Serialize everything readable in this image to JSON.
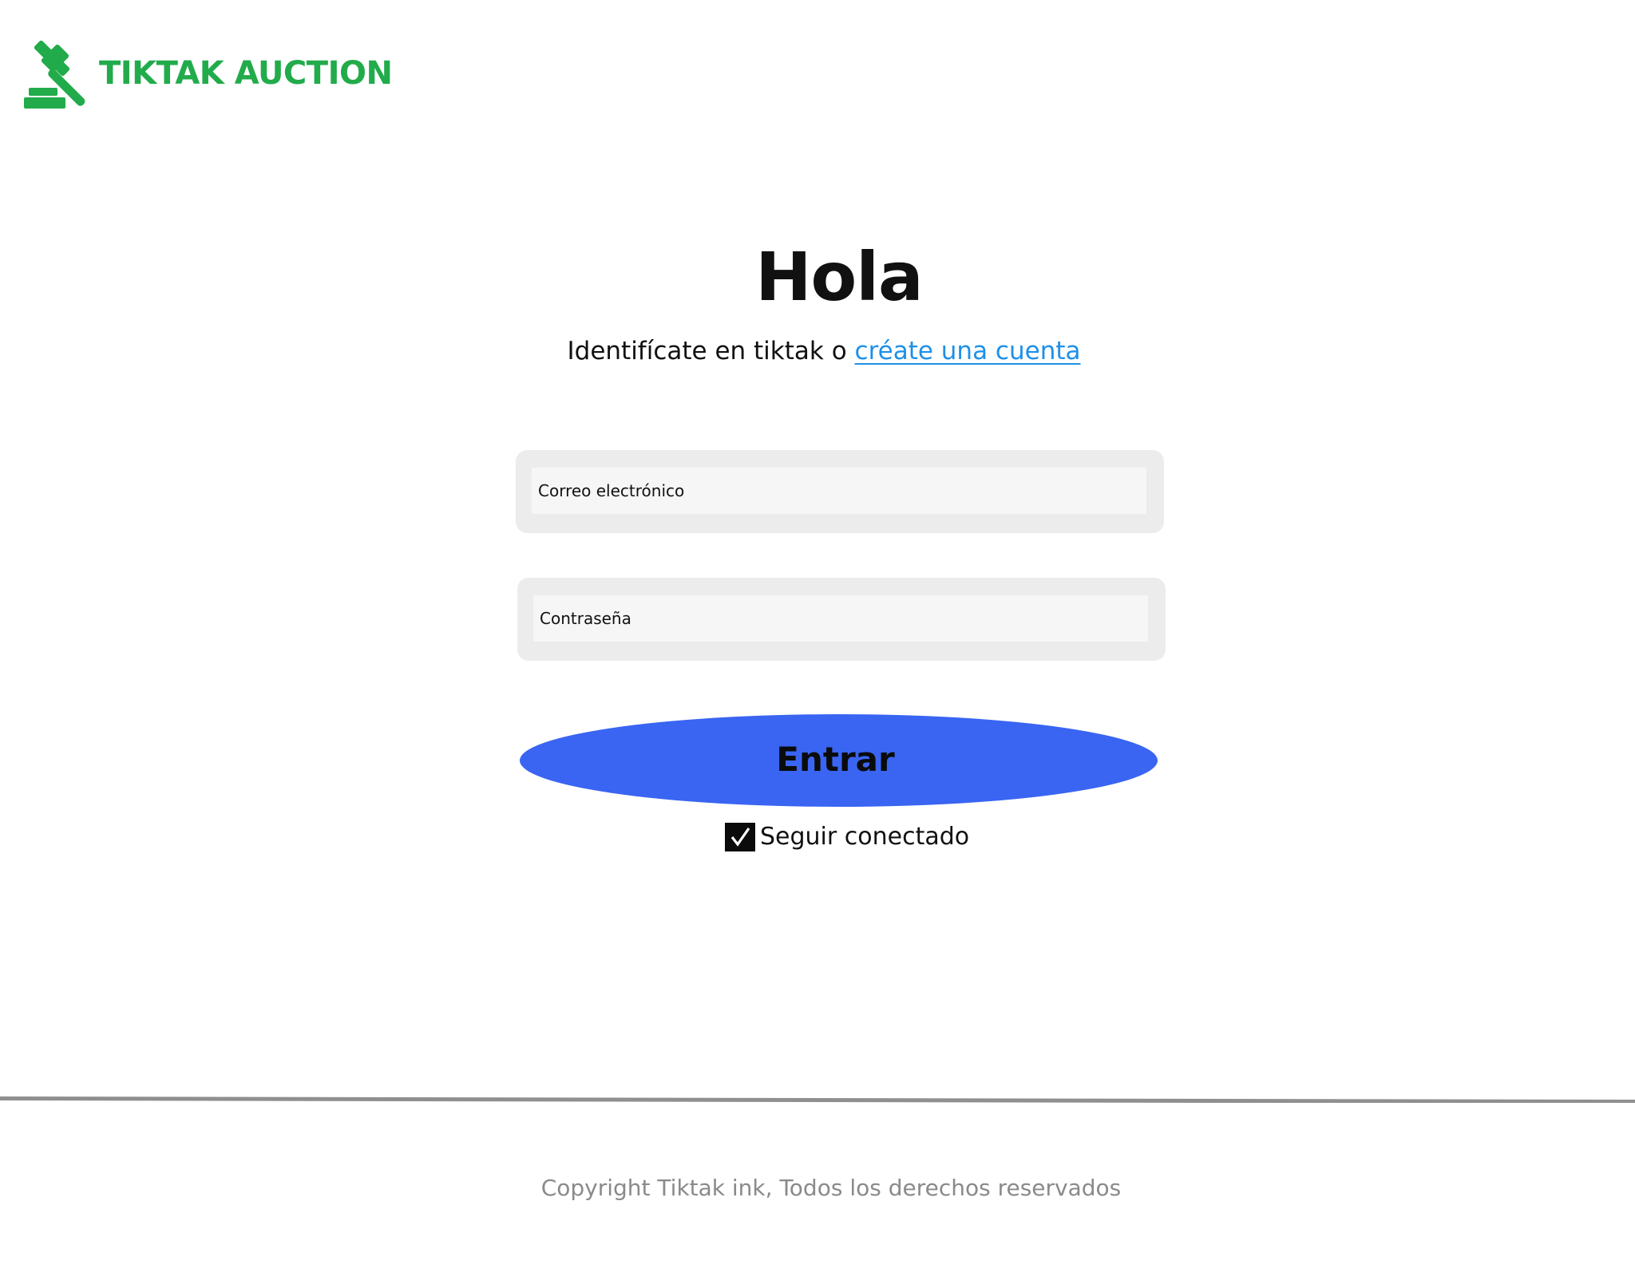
{
  "brand": {
    "name": "TIKTAK AUCTION",
    "color": "#22ab4b",
    "icon": "gavel-icon"
  },
  "login": {
    "title": "Hola",
    "subtitle_prefix": "Identifícate en tiktak o ",
    "signup_link": "créate una cuenta",
    "email_placeholder": "Correo electrónico",
    "email_value": "",
    "password_placeholder": "Contraseña",
    "password_value": "",
    "submit_label": "Entrar",
    "keep_connected_label": "Seguir conectado",
    "keep_connected_checked": true,
    "link_color": "#1e90e8",
    "button_color": "#3965f2"
  },
  "footer": {
    "copyright": "Copyright Tiktak ink, Todos los derechos reservados"
  }
}
